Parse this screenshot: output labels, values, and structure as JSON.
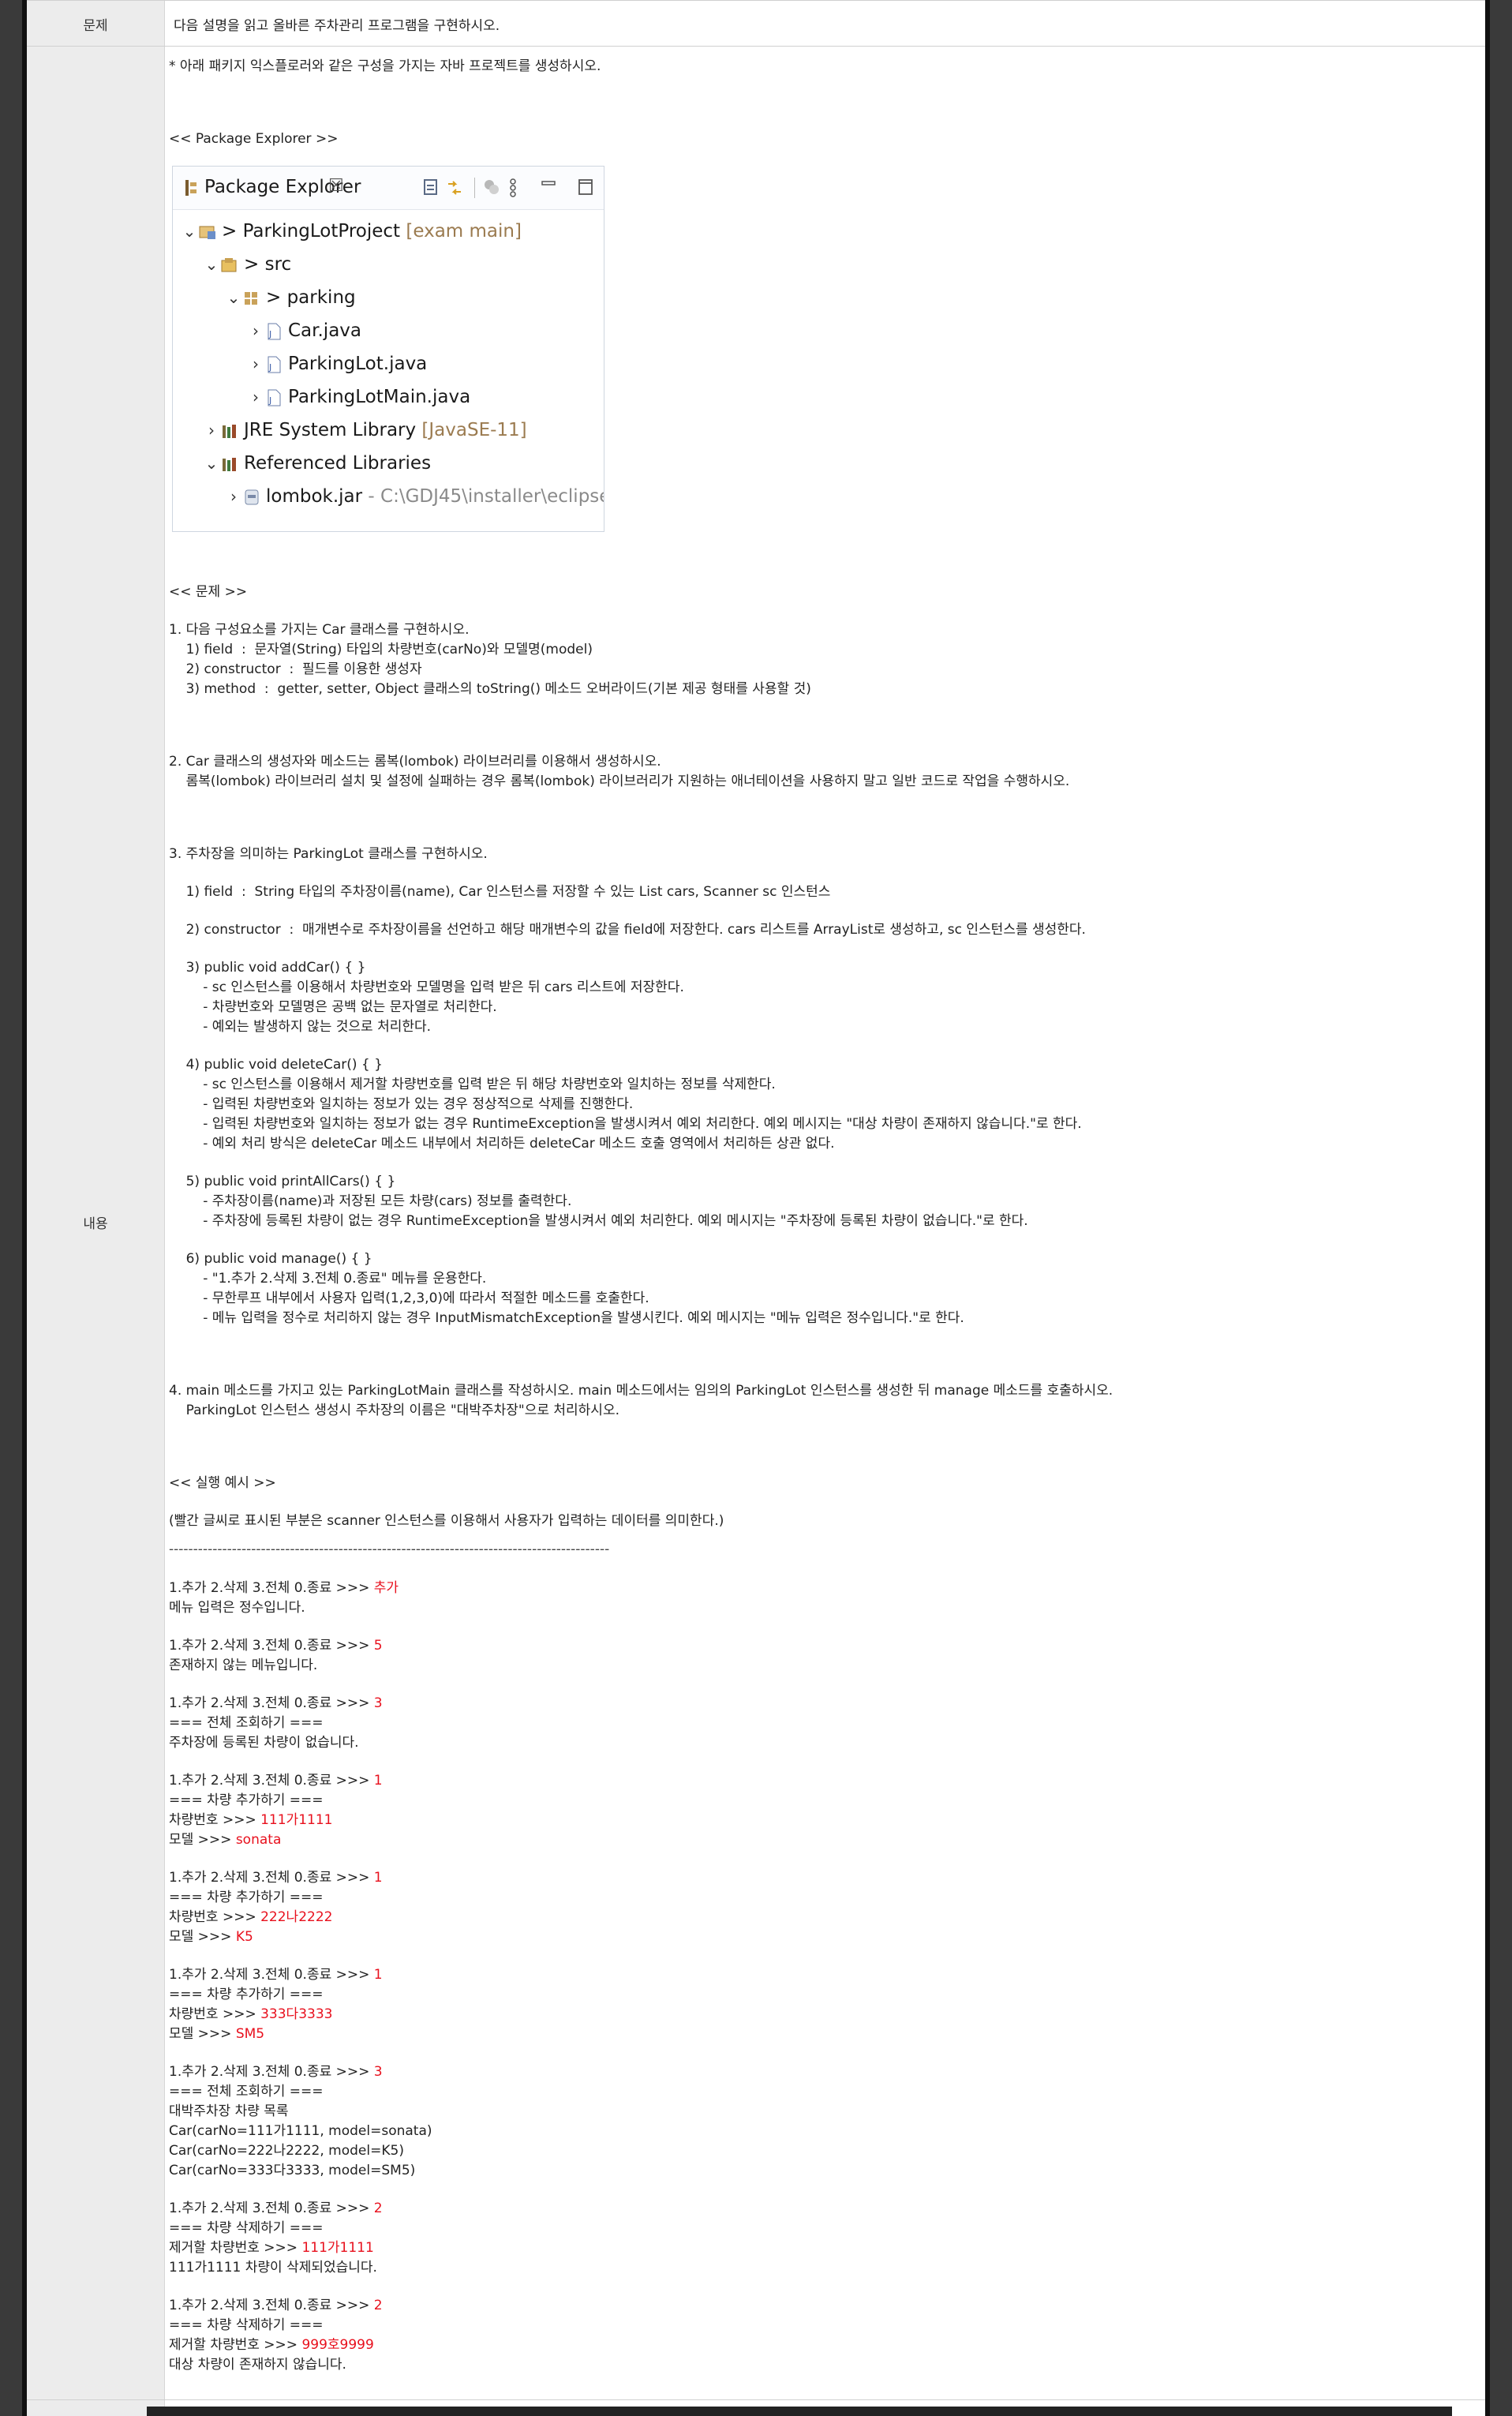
{
  "labels": {
    "problem": "문제",
    "content": "내용"
  },
  "title": "다음 설명을 읽고 올바른 주차관리 프로그램을 구현하시오.",
  "intro": "* 아래 패키지 익스플로러와 같은 구성을 가지는 자바 프로젝트를 생성하시오.",
  "pe_heading": "<< Package Explorer >>",
  "package_explorer": {
    "tab_label": "Package Explorer",
    "close_glyph": "☒",
    "tree": [
      {
        "text": "> ParkingLotProject",
        "extra": "[exam main]"
      },
      {
        "text": "> src",
        "extra": ""
      },
      {
        "text": "> parking",
        "extra": ""
      },
      {
        "text": "Car.java",
        "extra": ""
      },
      {
        "text": "ParkingLot.java",
        "extra": ""
      },
      {
        "text": "ParkingLotMain.java",
        "extra": ""
      },
      {
        "text": "JRE System Library",
        "extra": "[JavaSE-11]"
      },
      {
        "text": "Referenced Libraries",
        "extra": ""
      },
      {
        "text": "lombok.jar",
        "extra": "- C:\\GDJ45\\installer\\eclipse"
      }
    ]
  },
  "problem_heading": "<< 문제 >>",
  "problem_lines": [
    "1. 다음 구성요소를 가지는 Car 클래스를 구현하시오.",
    "    1) field  :  문자열(String) 타입의 차량번호(carNo)와 모델명(model)",
    "    2) constructor  :  필드를 이용한 생성자",
    "    3) method  :  getter, setter, Object 클래스의 toString() 메소드 오버라이드(기본 제공 형태를 사용할 것)",
    "2. Car 클래스의 생성자와 메소드는 롬복(lombok) 라이브러리를 이용해서 생성하시오.",
    "    롬복(lombok) 라이브러리 설치 및 설정에 실패하는 경우 롬복(lombok) 라이브러리가 지원하는 애너테이션을 사용하지 말고 일반 코드로 작업을 수행하시오.",
    "3. 주차장을 의미하는 ParkingLot 클래스를 구현하시오.",
    "    1) field  :  String 타입의 주차장이름(name), Car 인스턴스를 저장할 수 있는 List cars, Scanner sc 인스턴스",
    "    2) constructor  :  매개변수로 주차장이름을 선언하고 해당 매개변수의 값을 field에 저장한다. cars 리스트를 ArrayList로 생성하고, sc 인스턴스를 생성한다.",
    "    3) public void addCar() { }",
    "        - sc 인스턴스를 이용해서 차량번호와 모델명을 입력 받은 뒤 cars 리스트에 저장한다.",
    "        - 차량번호와 모델명은 공백 없는 문자열로 처리한다.",
    "        - 예외는 발생하지 않는 것으로 처리한다.",
    "    4) public void deleteCar() { }",
    "        - sc 인스턴스를 이용해서 제거할 차량번호를 입력 받은 뒤 해당 차량번호와 일치하는 정보를 삭제한다.",
    "        - 입력된 차량번호와 일치하는 정보가 있는 경우 정상적으로 삭제를 진행한다.",
    "        - 입력된 차량번호와 일치하는 정보가 없는 경우 RuntimeException을 발생시켜서 예외 처리한다. 예외 메시지는 \"대상 차량이 존재하지 않습니다.\"로 한다.",
    "        - 예외 처리 방식은 deleteCar 메소드 내부에서 처리하든 deleteCar 메소드 호출 영역에서 처리하든 상관 없다.",
    "    5) public void printAllCars() { }",
    "        - 주차장이름(name)과 저장된 모든 차량(cars) 정보를 출력한다.",
    "        - 주차장에 등록된 차량이 없는 경우 RuntimeException을 발생시켜서 예외 처리한다. 예외 메시지는 \"주차장에 등록된 차량이 없습니다.\"로 한다.",
    "    6) public void manage() { }",
    "        - \"1.추가 2.삭제 3.전체 0.종료\" 메뉴를 운용한다.",
    "        - 무한루프 내부에서 사용자 입력(1,2,3,0)에 따라서 적절한 메소드를 호출한다.",
    "        - 메뉴 입력을 정수로 처리하지 않는 경우 InputMismatchException을 발생시킨다. 예외 메시지는 \"메뉴 입력은 정수입니다.\"로 한다.",
    "4. main 메소드를 가지고 있는 ParkingLotMain 클래스를 작성하시오. main 메소드에서는 임의의 ParkingLot 인스턴스를 생성한 뒤 manage 메소드를 호출하시오.",
    "    ParkingLot 인스턴스 생성시 주차장의 이름은 \"대박주차장\"으로 처리하시오."
  ],
  "example_heading": "<< 실행 예시 >>",
  "example_note": "(빨간 글씨로 표시된 부분은 scanner 인스턴스를 이용해서 사용자가 입력하는 데이터를 의미한다.)",
  "separator": "-------------------------------------------------------------------------------------------",
  "menu_prompt": "1.추가 2.삭제 3.전체 0.종료 >>> ",
  "out": {
    "not_int": "메뉴 입력은 정수입니다.",
    "no_menu": "존재하지 않는 메뉴입니다.",
    "list_hdr": "=== 전체 조회하기 ===",
    "empty": "주차장에 등록된 차량이 없습니다.",
    "add_hdr": "=== 차량 추가하기 ===",
    "car_no_prompt": "차량번호 >>> ",
    "model_prompt": "모델 >>> ",
    "list_title": "대박주차장 차량 목록",
    "car1": "Car(carNo=111가1111, model=sonata)",
    "car2": "Car(carNo=222나2222, model=K5)",
    "car3": "Car(carNo=333다3333, model=SM5)",
    "del_hdr": "=== 차량 삭제하기 ===",
    "del_prompt": "제거할 차량번호 >>> ",
    "deleted": "111가1111 차량이 삭제되었습니다.",
    "not_found": "대상 차량이 존재하지 않습니다."
  },
  "inputs": {
    "i1": "추가",
    "i2": "5",
    "i3": "3",
    "i4": "1",
    "i5": "111가1111",
    "i6": "sonata",
    "i7": "1",
    "i8": "222나2222",
    "i9": "K5",
    "i10": "1",
    "i11": "333다3333",
    "i12": "SM5",
    "i13": "3",
    "i14": "2",
    "i15": "111가1111",
    "i16": "2",
    "i17": "999호9999"
  }
}
